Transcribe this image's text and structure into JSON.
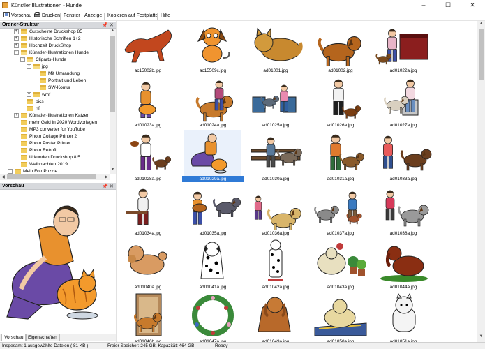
{
  "window": {
    "title": "Künstler Illustrationen - Hunde",
    "controls": [
      "–",
      "☐",
      "✕"
    ]
  },
  "menu": {
    "items": [
      {
        "label": "Vorschau",
        "icon": "preview-icon"
      },
      {
        "label": "Drucken",
        "icon": "print-icon"
      },
      {
        "label": "Fenster"
      },
      {
        "label": "Anzeige"
      },
      {
        "label": "Kopieren auf Festplatte"
      },
      {
        "label": "Hilfe"
      }
    ]
  },
  "folder_panel": {
    "title": "Ordner-Struktur",
    "pin": "📌",
    "close": "✕",
    "tree": [
      {
        "label": "Gutscheine Druckshop 85",
        "level": 2,
        "exp": "+",
        "folder": true
      },
      {
        "label": "Historische Schriften 1+2",
        "level": 2,
        "exp": "+",
        "folder": true
      },
      {
        "label": "Hochzeit DruckShop",
        "level": 2,
        "exp": "+",
        "folder": true
      },
      {
        "label": "Künstler-Illustrationen Hunde",
        "level": 2,
        "exp": "−",
        "folder": true,
        "open": true
      },
      {
        "label": "Cliparts-Hunde",
        "level": 3,
        "exp": "−",
        "folder": true,
        "open": true
      },
      {
        "label": "jpg",
        "level": 4,
        "exp": "−",
        "folder": true,
        "open": true
      },
      {
        "label": "Mit Umrandung",
        "level": 5,
        "folder": true
      },
      {
        "label": "Portrait und Leben",
        "level": 5,
        "folder": true
      },
      {
        "label": "SW-Kontur",
        "level": 5,
        "folder": true
      },
      {
        "label": "wmf",
        "level": 4,
        "exp": "+",
        "folder": true
      },
      {
        "label": "pics",
        "level": 3,
        "folder": true
      },
      {
        "label": "rtf",
        "level": 3,
        "folder": true
      },
      {
        "label": "Künstler-Illustrationen Katzen",
        "level": 2,
        "exp": "+",
        "folder": true
      },
      {
        "label": "mehr Geld in 2020 Wordvorlagen",
        "level": 2,
        "folder": true
      },
      {
        "label": "MP3 converter for YouTube",
        "level": 2,
        "folder": true
      },
      {
        "label": "Photo Collage Printer 2",
        "level": 2,
        "folder": true
      },
      {
        "label": "Photo Poster Printer",
        "level": 2,
        "folder": true
      },
      {
        "label": "Photo Retrofit",
        "level": 2,
        "folder": true
      },
      {
        "label": "Urkunden Druckshop 8.5",
        "level": 2,
        "folder": true
      },
      {
        "label": "Weihnachten 2019",
        "level": 2,
        "folder": true
      },
      {
        "label": "Mein FotoPuzzle",
        "level": 1,
        "exp": "+",
        "folder": true
      }
    ]
  },
  "preview_panel": {
    "title": "Vorschau",
    "pin": "📌",
    "close": "✕"
  },
  "bottom_tabs": [
    {
      "label": "Vorschau",
      "active": true
    },
    {
      "label": "Eigenschaften",
      "active": false
    }
  ],
  "thumbnails": [
    {
      "caption": "ac15002b.jpg",
      "art": "dog-orange"
    },
    {
      "caption": "ac15509c.jpg",
      "art": "dog-cartoon"
    },
    {
      "caption": "ad01001.jpg",
      "art": "cat-lying"
    },
    {
      "caption": "ad01002.jpg",
      "art": "dog-sharpei"
    },
    {
      "caption": "ad01022a.jpg",
      "art": "woman-piano"
    },
    {
      "caption": "ad01023a.jpg",
      "art": "woman-cat"
    },
    {
      "caption": "ad01024a.jpg",
      "art": "woman-dog"
    },
    {
      "caption": "ad01025a.jpg",
      "art": "woman-chairs"
    },
    {
      "caption": "ad01026a.jpg",
      "art": "man-dog-walk"
    },
    {
      "caption": "ad01027a.jpg",
      "art": "woman-dog-chair"
    },
    {
      "caption": "ad01028a.jpg",
      "art": "man-violin"
    },
    {
      "caption": "ad01029a.jpg",
      "art": "woman-cat-feeding",
      "selected": true
    },
    {
      "caption": "ad01030a.jpg",
      "art": "man-bench"
    },
    {
      "caption": "ad01031a.jpg",
      "art": "woman-sitting-dog"
    },
    {
      "caption": "ad01033a.jpg",
      "art": "man-running-dog"
    },
    {
      "caption": "ad01034a.jpg",
      "art": "man-guitar-seat"
    },
    {
      "caption": "ad01035a.jpg",
      "art": "man-guitar-dog"
    },
    {
      "caption": "ad01036a.jpg",
      "art": "woman-dog-lying"
    },
    {
      "caption": "ad01037a.jpg",
      "art": "man-dogs"
    },
    {
      "caption": "ad01038a.jpg",
      "art": "woman-sheepdog"
    },
    {
      "caption": "ad01040a.jpg",
      "art": "poodle"
    },
    {
      "caption": "ad01041a.jpg",
      "art": "dalmatian-sit"
    },
    {
      "caption": "ad01042a.jpg",
      "art": "dalmatian-stand"
    },
    {
      "caption": "ad01043a.jpg",
      "art": "dog-plants"
    },
    {
      "caption": "ad01044a.jpg",
      "art": "spaniel-grass"
    },
    {
      "caption": "ad01046b.jpg",
      "art": "dog-door"
    },
    {
      "caption": "ad01047a.jpg",
      "art": "flower-wreath"
    },
    {
      "caption": "ad01049a.jpg",
      "art": "golden-retriever"
    },
    {
      "caption": "ad01050a.jpg",
      "art": "dog-blanket"
    },
    {
      "caption": "ad01051a.jpg",
      "art": "westie"
    }
  ],
  "status": {
    "left": "Insgesamt 1 ausgewählte Dateien ( 81 KB )",
    "middle": "Freier Speicher: 245 GB, Kapazität: 464 GB",
    "right": "Ready"
  },
  "colors": {
    "selection": "#2f7ad6",
    "panel_header": "#d7d9dd",
    "folder": "#f2cd5c",
    "accent_orange": "#e8912e",
    "accent_purple": "#6a4aa6"
  }
}
